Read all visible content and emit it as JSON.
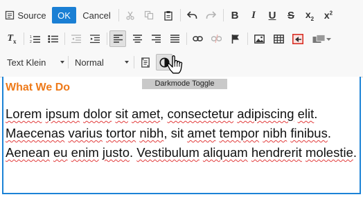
{
  "toolbar": {
    "source_label": "Source",
    "ok_label": "OK",
    "cancel_label": "Cancel",
    "font_size_combo": "Text Klein",
    "format_combo": "Normal"
  },
  "tooltip": "Darkmode Toggle",
  "content": {
    "heading": "What We Do",
    "text": [
      {
        "t": "Lorem",
        "sp": true
      },
      {
        "t": " ",
        "sp": false
      },
      {
        "t": "ipsum",
        "sp": true
      },
      {
        "t": " ",
        "sp": false
      },
      {
        "t": "dolor",
        "sp": true
      },
      {
        "t": " ",
        "sp": false
      },
      {
        "t": "sit",
        "sp": true
      },
      {
        "t": " ",
        "sp": false
      },
      {
        "t": "amet",
        "sp": true
      },
      {
        "t": ", ",
        "sp": false
      },
      {
        "t": "consectetur",
        "sp": true
      },
      {
        "t": " ",
        "sp": false
      },
      {
        "t": "adipiscing",
        "sp": true
      },
      {
        "t": " ",
        "sp": false
      },
      {
        "t": "elit",
        "sp": true
      },
      {
        "t": ". ",
        "sp": false
      },
      {
        "t": "Maecenas",
        "sp": true
      },
      {
        "t": " ",
        "sp": false
      },
      {
        "t": "varius",
        "sp": true
      },
      {
        "t": " ",
        "sp": false
      },
      {
        "t": "tortor",
        "sp": true
      },
      {
        "t": " ",
        "sp": false
      },
      {
        "t": "nibh",
        "sp": true
      },
      {
        "t": ", sit ",
        "sp": false
      },
      {
        "t": "amet",
        "sp": true
      },
      {
        "t": " ",
        "sp": false
      },
      {
        "t": "tempor",
        "sp": true
      },
      {
        "t": " ",
        "sp": false
      },
      {
        "t": "nibh",
        "sp": true
      },
      {
        "t": " ",
        "sp": false
      },
      {
        "t": "finibus",
        "sp": true
      },
      {
        "t": ". ",
        "sp": false
      },
      {
        "t": "Aenean",
        "sp": true
      },
      {
        "t": " ",
        "sp": false
      },
      {
        "t": "eu",
        "sp": true
      },
      {
        "t": " ",
        "sp": false
      },
      {
        "t": "enim",
        "sp": true
      },
      {
        "t": " ",
        "sp": false
      },
      {
        "t": "justo",
        "sp": true
      },
      {
        "t": ". ",
        "sp": false
      },
      {
        "t": "Vestibulum",
        "sp": true
      },
      {
        "t": " ",
        "sp": false
      },
      {
        "t": "aliquam",
        "sp": true
      },
      {
        "t": " ",
        "sp": false
      },
      {
        "t": "hendrerit",
        "sp": true
      },
      {
        "t": " ",
        "sp": false
      },
      {
        "t": "molestie",
        "sp": true
      },
      {
        "t": ".",
        "sp": false
      }
    ]
  },
  "colors": {
    "accent": "#1a7fd4",
    "heading": "#ee7a1a",
    "spellcheck": "#e23b3b",
    "image_icon_red": "#d93025"
  }
}
